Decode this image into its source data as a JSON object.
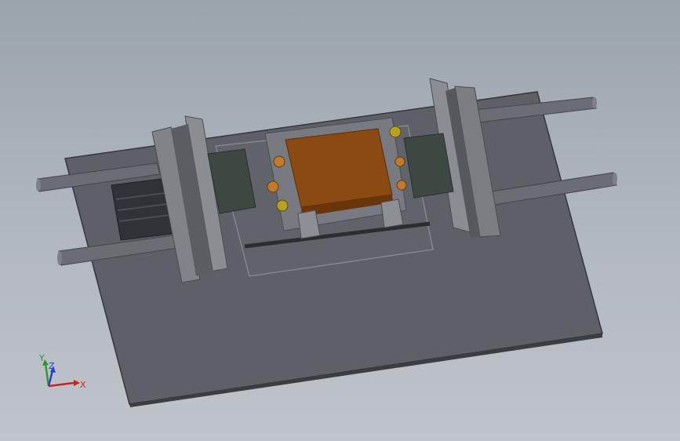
{
  "viewport": {
    "background_top": "#9aa4ac",
    "background_bottom": "#bfc4ca"
  },
  "colors": {
    "base_plate": "#5f6268",
    "base_edge": "#3c3f44",
    "steel_light": "#8a8d92",
    "steel_dark": "#4a4d52",
    "rod": "#6c7076",
    "block_dark": "#3f4a44",
    "copper": "#8b4a12",
    "copper_top": "#a3561a",
    "coil": "#b8a020"
  },
  "triad": {
    "x_label": "X",
    "y_label": "Y",
    "z_label": "Z",
    "x_color": "#cc2222",
    "y_color": "#2a9a2a",
    "z_color": "#2244cc"
  }
}
